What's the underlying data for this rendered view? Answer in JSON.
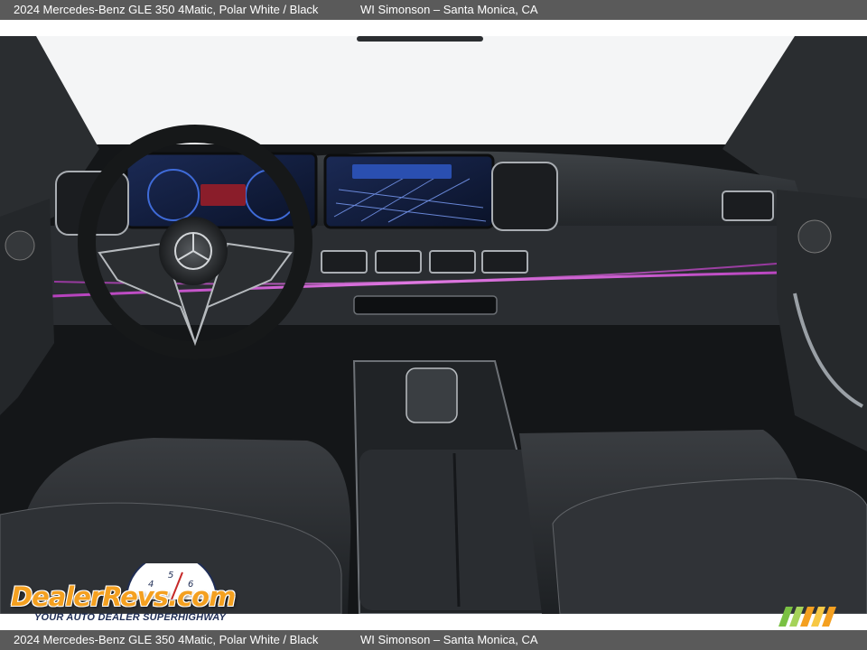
{
  "caption": {
    "vehicle": "2024 Mercedes-Benz GLE 350 4Matic,  Polar White / Black",
    "dealer": "WI Simonson – Santa Monica, CA"
  },
  "watermark": {
    "brand": "DealerRevs.com",
    "tagline": "YOUR AUTO DEALER SUPERHIGHWAY",
    "gauge_digits": [
      "4",
      "5",
      "6"
    ]
  },
  "colors": {
    "caption_bar": "#5a5a5a",
    "ambient_light": "#d65ad8",
    "brand_orange": "#f4a020",
    "brand_navy": "#1f2d55",
    "screen_glow": "#2a4fb0"
  },
  "icons": {
    "steering_emblem": "three-pointed-star-icon",
    "corner_stripes": "speed-stripes-icon"
  }
}
